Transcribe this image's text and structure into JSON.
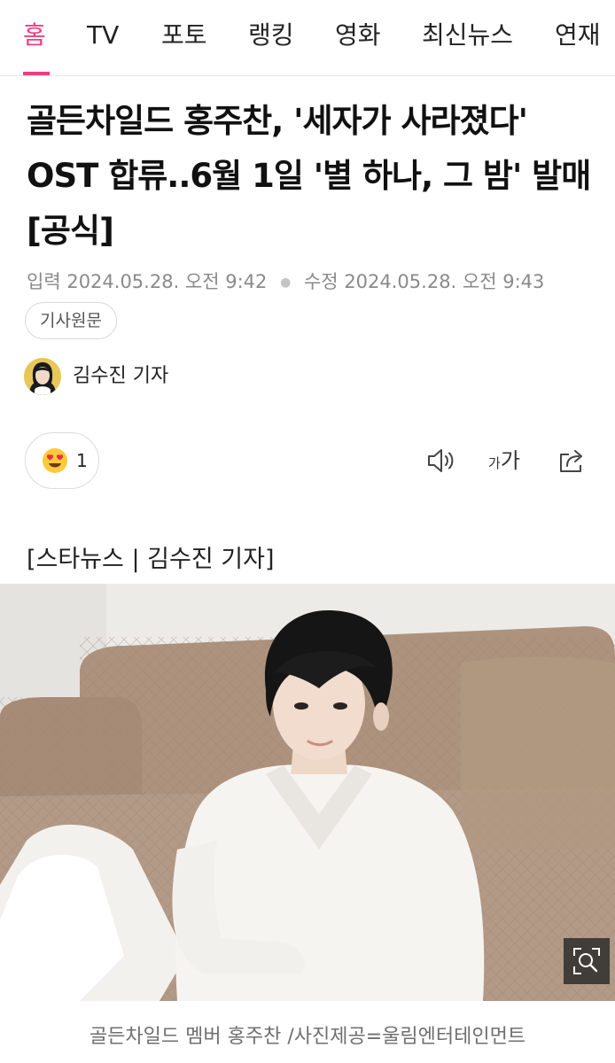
{
  "nav": {
    "tabs": [
      {
        "label": "홈",
        "active": true
      },
      {
        "label": "TV",
        "active": false
      },
      {
        "label": "포토",
        "active": false
      },
      {
        "label": "랭킹",
        "active": false
      },
      {
        "label": "영화",
        "active": false
      },
      {
        "label": "최신뉴스",
        "active": false
      },
      {
        "label": "연재",
        "active": false
      }
    ],
    "accent_color": "#ef3e82"
  },
  "article": {
    "headline": "골든차일드 홍주찬, '세자가 사라졌다' OST 합류..6월 1일 '별 하나, 그 밤' 발매 [공식]",
    "published_label": "입력",
    "published_time": "2024.05.28. 오전 9:42",
    "modified_label": "수정",
    "modified_time": "2024.05.28. 오전 9:43",
    "original_link_label": "기사원문",
    "reporter": {
      "name": "김수진 기자",
      "avatar_icon": "reporter-avatar"
    },
    "reaction": {
      "emoji_icon": "heart-eyes-emoji-icon",
      "count": "1"
    },
    "tools": {
      "tts_icon": "speaker-icon",
      "font_size_small": "가",
      "font_size_big": "가",
      "share_icon": "share-icon"
    },
    "source_line": "[스타뉴스 | 김수진 기자]",
    "photo": {
      "zoom_icon": "zoom-search-icon"
    },
    "photo_caption": "골든차일드 멤버 홍주찬 /사진제공=울림엔터테인먼트"
  }
}
